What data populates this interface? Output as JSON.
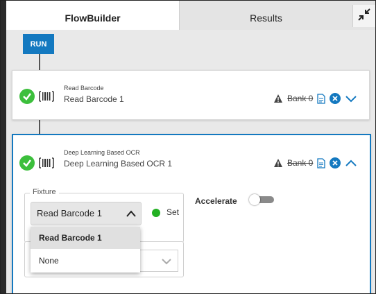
{
  "tabs": {
    "flowbuilder": "FlowBuilder",
    "results": "Results"
  },
  "run_label": "RUN",
  "steps": [
    {
      "type_label": "Read Barcode",
      "name": "Read Barcode 1",
      "bank": "Bank 0"
    },
    {
      "type_label": "Deep Learning Based OCR",
      "name": "Deep Learning Based OCR 1",
      "bank": "Bank 0"
    }
  ],
  "fixture": {
    "legend": "Fixture",
    "selected": "Read Barcode 1",
    "set_label": "Set",
    "options": [
      "Read Barcode 1",
      "None"
    ]
  },
  "accelerate": {
    "label": "Accelerate",
    "enabled": false
  },
  "colors": {
    "accent": "#1479c0",
    "success": "#3cbf3c"
  },
  "icons": [
    "check-circle-icon",
    "barcode-icon",
    "warning-icon",
    "document-icon",
    "close-circle-icon",
    "chevron-down-icon",
    "chevron-up-icon",
    "collapse-icon"
  ]
}
